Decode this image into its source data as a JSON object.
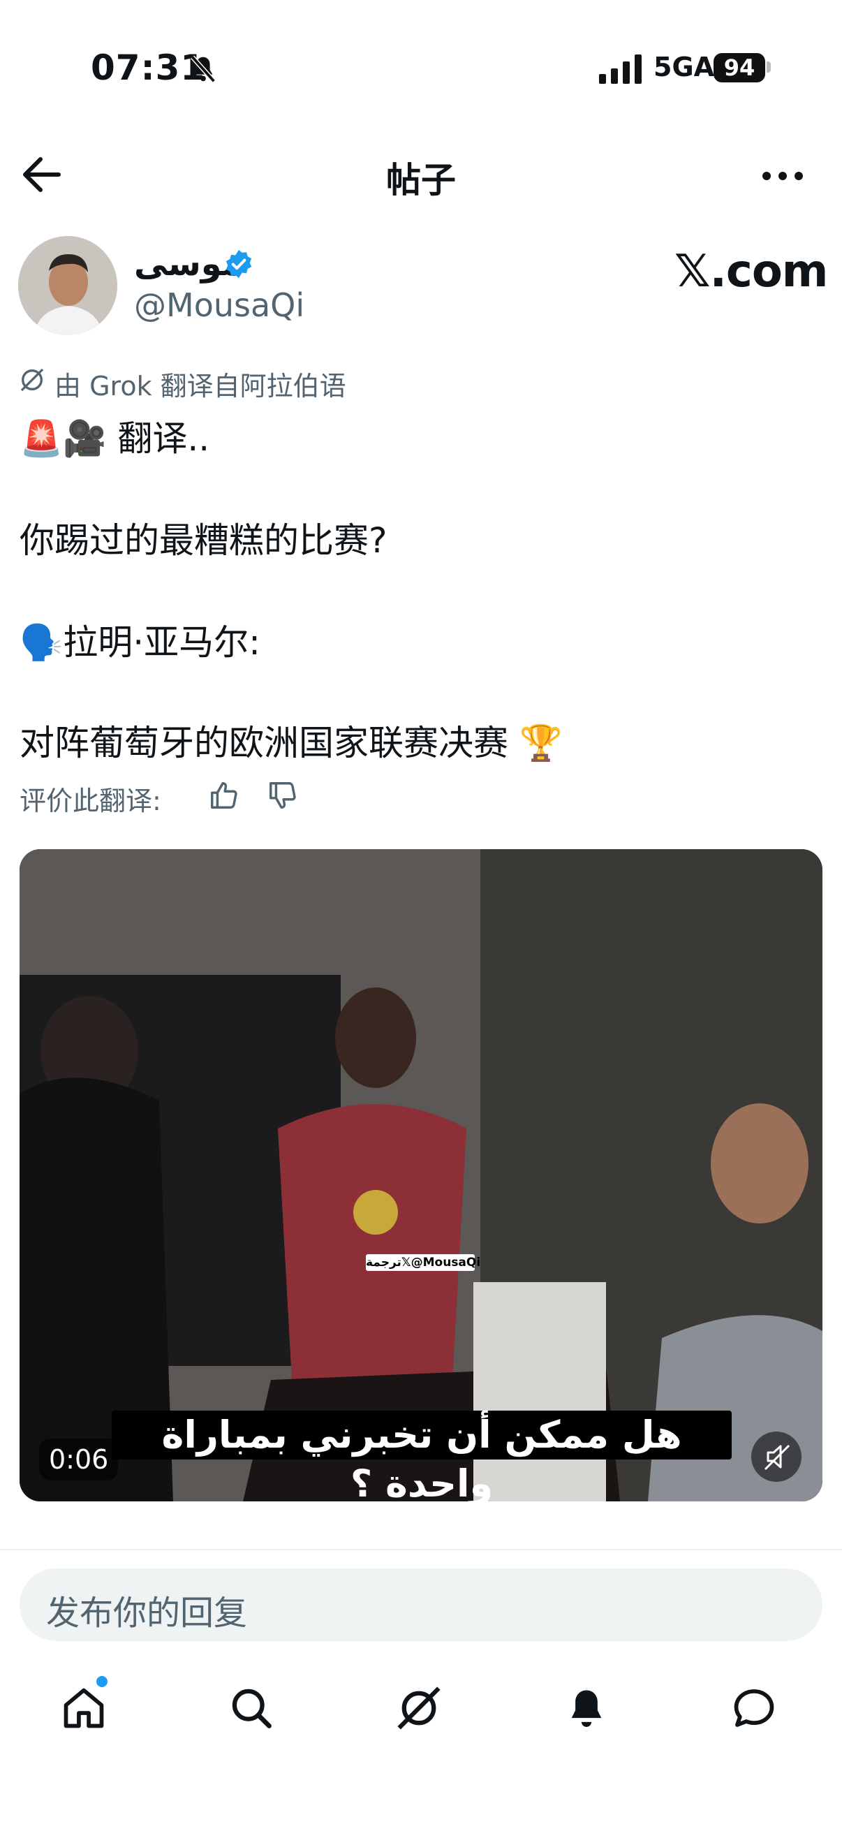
{
  "status_bar": {
    "time": "07:31",
    "network": "5GA",
    "battery": "94"
  },
  "header": {
    "title": "帖子"
  },
  "author": {
    "display_name": "موسى",
    "handle": "@MousaQi",
    "site": "𝕏.com"
  },
  "translation_note": "由 Grok 翻译自阿拉伯语",
  "post": {
    "line1": "🚨🎥 翻译..",
    "line2": "你踢过的最糟糕的比赛?",
    "line3": "🗣️拉明·亚马尔:",
    "line4": "对阵葡萄牙的欧洲国家联赛决赛 🏆"
  },
  "rate": {
    "label": "评价此翻译:"
  },
  "video": {
    "watermark": "ترجمة𝕏@MousaQi",
    "subtitle": "هل ممكن أن تخبرني بمباراة واحدة ؟",
    "duration": "0:06"
  },
  "reply": {
    "placeholder": "发布你的回复"
  },
  "colors": {
    "accent": "#1d9bf0",
    "secondary_text": "#536471"
  }
}
